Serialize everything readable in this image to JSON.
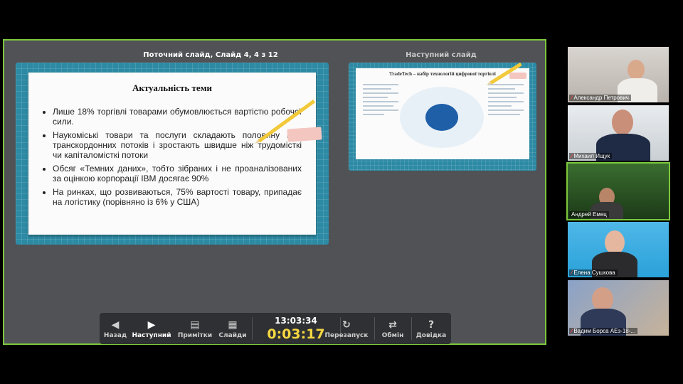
{
  "presenter": {
    "current_caption": "Поточний слайд, Слайд 4, 4 з 12",
    "next_caption": "Наступний слайд",
    "current_slide": {
      "title": "Актуальність теми",
      "bullets": [
        "Лише 18% торгівлі товарами обумовлюється вартістю робочої сили.",
        "Наукоміські товари та послуги складають половину всіх транскордонних потоків і зростають швидше ніж трудомісткі чи капіталомісткі потоки",
        "Обсяг «Темних даних», тобто зібраних і не проаналізованих за оцінкою корпорації IBM досягає 90%",
        "На ринках, що розвиваються,  75% вартості товару, припадає на логістику (порівняно із  6% у США)"
      ]
    },
    "next_slide": {
      "title": "TradeTech – набір технологій цифрової торгівлі"
    }
  },
  "toolbar": {
    "back": "Назад",
    "next": "Наступний",
    "notes": "Примітки",
    "slides": "Слайди",
    "clock": "13:03:34",
    "timer": "0:03:17",
    "restart": "Перезапуск",
    "swap": "Обмін",
    "help": "Довідка"
  },
  "participants": [
    {
      "name": "Александр Петрович"
    },
    {
      "name": "Михаил Ищук"
    },
    {
      "name": "Андрей Емец"
    },
    {
      "name": "Елена Сушкова"
    },
    {
      "name": "Вадим Борса АЕз-18-..."
    }
  ],
  "colors": {
    "active_border": "#7cc83c",
    "timer": "#f5d742",
    "slide_bg": "#2c8aa4",
    "mic_muted": "#ff4a3a"
  }
}
